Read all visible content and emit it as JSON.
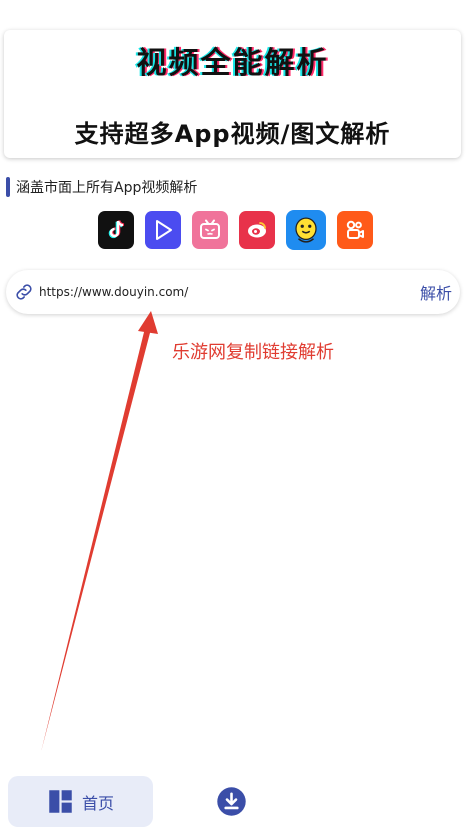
{
  "banner": {
    "title": "视频全能解析",
    "subtitle": "支持超多App视频/图文解析"
  },
  "section": {
    "label": "涵盖市面上所有App视频解析"
  },
  "platforms": [
    {
      "icon": "tiktok-icon",
      "color": "#111111"
    },
    {
      "icon": "play-triangle-icon",
      "color": "#4b4cf0"
    },
    {
      "icon": "bilibili-tv-icon",
      "color": "#f0739a"
    },
    {
      "icon": "weibo-eye-icon",
      "color": "#e8324a"
    },
    {
      "icon": "qq-penguin-icon",
      "color": "#1f8cf0"
    },
    {
      "icon": "kuaishou-camera-icon",
      "color": "#ff5a19"
    }
  ],
  "search": {
    "value": "https://www.douyin.com/",
    "parse_label": "解析"
  },
  "annotation": {
    "text": "乐游网复制链接解析",
    "color": "#e03c31"
  },
  "nav": {
    "home_label": "首页",
    "accent": "#3b4ea8"
  }
}
